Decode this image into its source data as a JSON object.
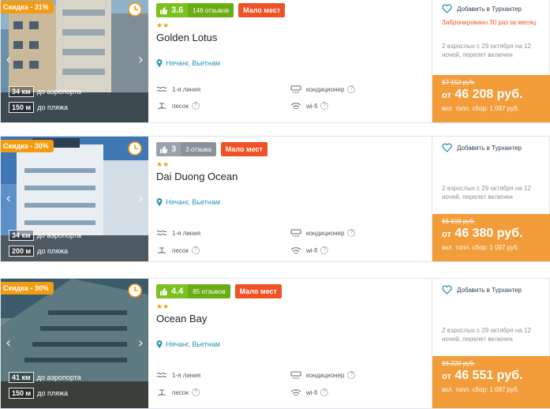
{
  "colors": {
    "accent_orange": "#f39c12",
    "rating_green": "#7cc11f",
    "rating_grey": "#9aa3ab",
    "few_places_red": "#ef5225",
    "location_blue": "#2a94b8"
  },
  "hotels": [
    {
      "discount": "Скидка - 31%",
      "rating": "3.6",
      "reviews": "146 отзывов",
      "rating_style": "green",
      "few_places": "Мало мест",
      "stars": "★★",
      "name": "Golden Lotus",
      "location": "Нячанг, Вьетнам",
      "distance_airport_value": "34 км",
      "distance_airport_label": "до аэропорта",
      "distance_beach_value": "150 м",
      "distance_beach_label": "до пляжа",
      "features": [
        "1-я линия",
        "кондиционер",
        "песок",
        "wi-fi"
      ],
      "favorite_label": "Добавить в Турхантер",
      "booked_note": "Забронировано 30 раз за месяц",
      "tour_info": "2 взрослых с 29 октября на 12 ночей, перелет включен",
      "old_price": "67 152 руб.",
      "price_prefix": "от",
      "price": "46 208 руб.",
      "fuel_fee": "вкл. топл. сбор: 1 097 руб."
    },
    {
      "discount": "Скидка - 30%",
      "rating": "3",
      "reviews": "3 отзыва",
      "rating_style": "grey",
      "few_places": "Мало мест",
      "stars": "★★",
      "name": "Dai Duong Ocean",
      "location": "Нячанг, Вьетнам",
      "distance_airport_value": "34 км",
      "distance_airport_label": "до аэропорта",
      "distance_beach_value": "200 м",
      "distance_beach_label": "до пляжа",
      "features": [
        "1-я линия",
        "кондиционер",
        "песок",
        "wi-fi"
      ],
      "favorite_label": "Добавить в Турхантер",
      "booked_note": "",
      "tour_info": "2 взрослых с 29 октября на 12 ночей, перелет включен",
      "old_price": "66 698 руб.",
      "price_prefix": "от",
      "price": "46 380 руб.",
      "fuel_fee": "вкл. топл. сбор: 1 097 руб."
    },
    {
      "discount": "Скидка - 30%",
      "rating": "4.4",
      "reviews": "85 отзывов",
      "rating_style": "green",
      "few_places": "Мало мест",
      "stars": "★★",
      "name": "Ocean Bay",
      "location": "Нячанг, Вьетнам",
      "distance_airport_value": "41 км",
      "distance_airport_label": "до аэропорта",
      "distance_beach_value": "150 м",
      "distance_beach_label": "до пляжа",
      "features": [
        "1-я линия",
        "кондиционер",
        "песок",
        "wi-fi"
      ],
      "favorite_label": "Добавить в Турхантер",
      "booked_note": "",
      "tour_info": "2 взрослых с 29 октября на 12 ночей, перелет включен",
      "old_price": "66 220 руб.",
      "price_prefix": "от",
      "price": "46 551 руб.",
      "fuel_fee": "вкл. топл. сбор: 1 097 руб."
    }
  ]
}
